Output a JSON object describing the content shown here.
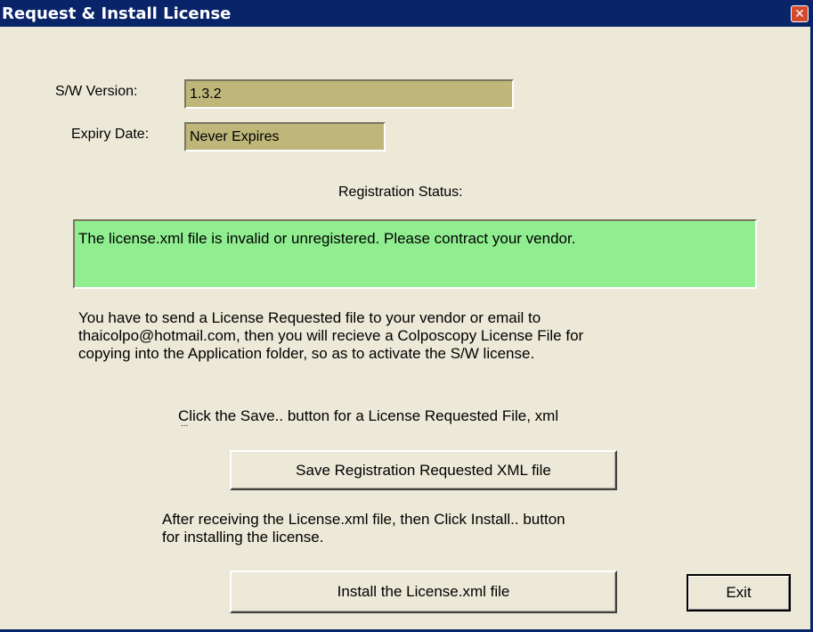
{
  "window": {
    "title": "Request & Install License",
    "close_glyph": "✕"
  },
  "form": {
    "sw_version_label": "S/W Version:",
    "sw_version_value": "1.3.2",
    "expiry_label": "Expiry Date:",
    "expiry_value": "Never Expires"
  },
  "status": {
    "heading": "Registration Status:",
    "message": "The license.xml file is invalid or unregistered. Please contract your vendor."
  },
  "instructions": {
    "line1": "You have to send a License Requested file to your vendor or email to",
    "line2": "thaicolpo@hotmail.com, then you will recieve a Colposcopy License File for",
    "line3": "copying into the Application folder, so as to activate the S/W license.",
    "save_hint": "Click the Save.. button for a License Requested File, xml",
    "save_hint_dots": "...",
    "install_hint_line1": "After receiving the License.xml file, then Click Install.. button",
    "install_hint_line2": "for installing the license."
  },
  "buttons": {
    "save_label": "Save Registration Requested XML file",
    "install_label": "Install the License.xml file",
    "exit_label": "Exit"
  },
  "colors": {
    "titlebar": "#0a246a",
    "dialog_bg": "#ece9d8",
    "field_bg": "#bfb67a",
    "status_bg": "#90ee90",
    "close_button": "#d44a2c"
  }
}
